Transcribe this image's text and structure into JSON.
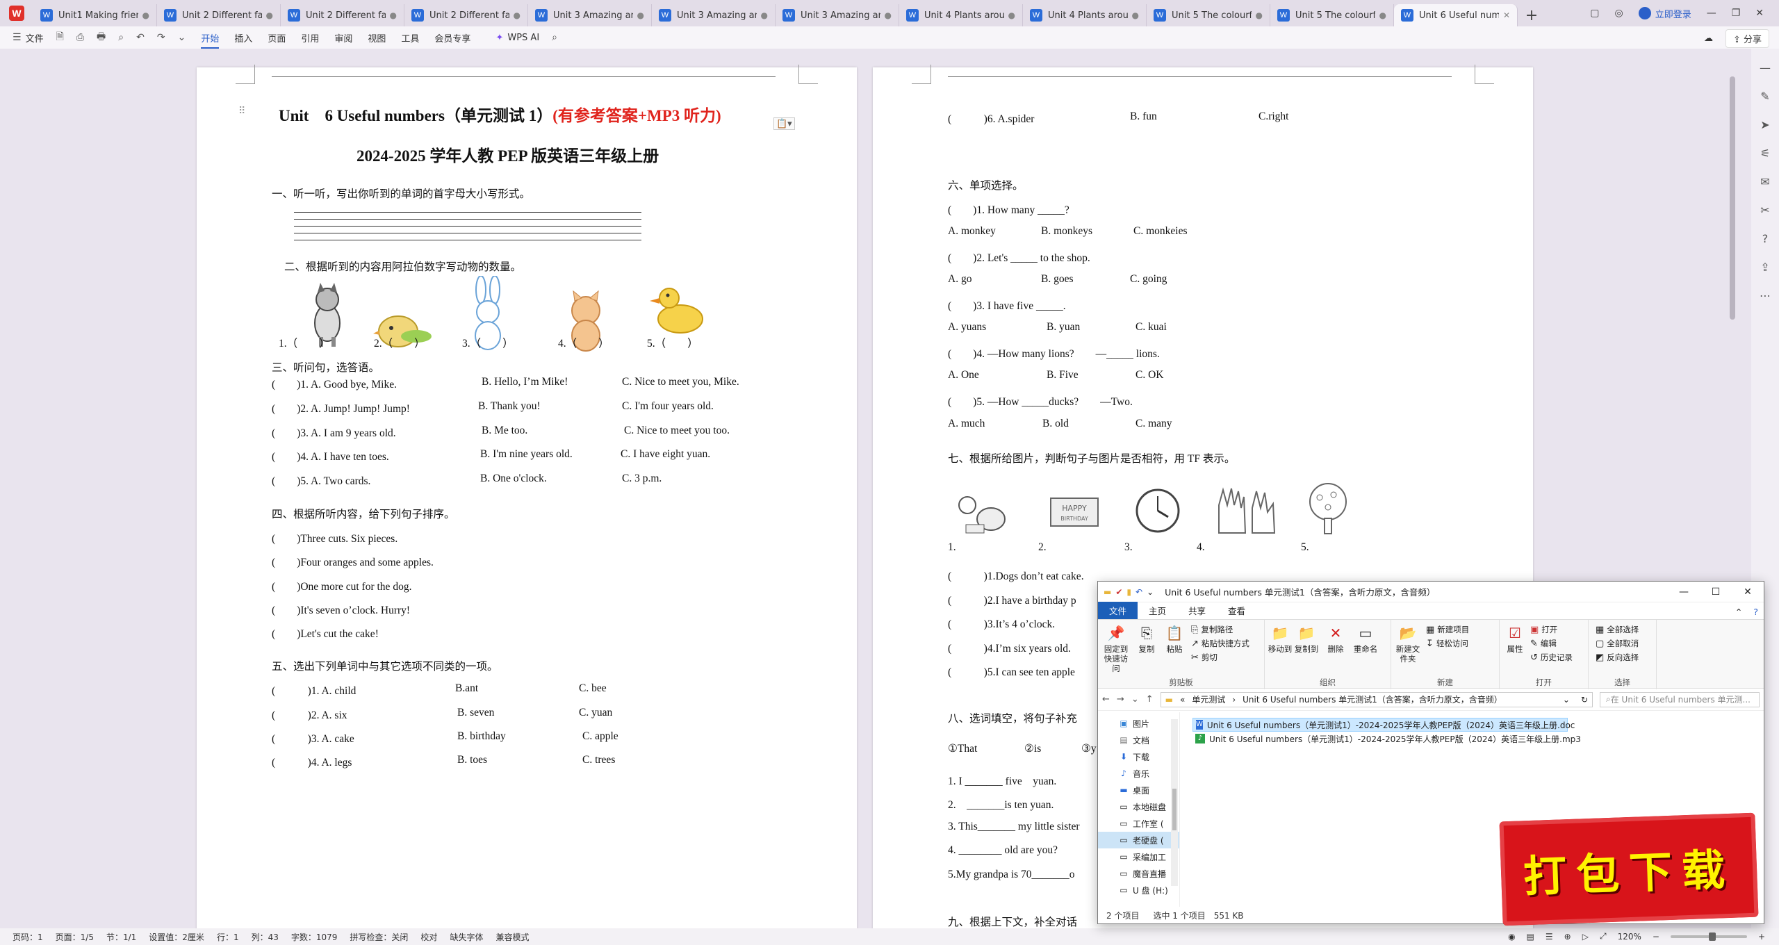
{
  "tabs": [
    {
      "label": "Unit1 Making friends"
    },
    {
      "label": "Unit 2 Different families"
    },
    {
      "label": "Unit 2 Different families"
    },
    {
      "label": "Unit 2 Different families"
    },
    {
      "label": "Unit 3 Amazing animals"
    },
    {
      "label": "Unit 3 Amazing animals"
    },
    {
      "label": "Unit 3 Amazing animals"
    },
    {
      "label": "Unit 4 Plants around us"
    },
    {
      "label": "Unit 4 Plants around us"
    },
    {
      "label": "Unit 5 The colourful world"
    },
    {
      "label": "Unit 5 The colourful world"
    },
    {
      "label": "Unit 6 Useful numbers"
    }
  ],
  "titlebar": {
    "login": "立即登录"
  },
  "menu": {
    "file": "文件",
    "items": [
      "开始",
      "插入",
      "页面",
      "引用",
      "审阅",
      "视图",
      "工具",
      "会员专享"
    ],
    "wps_ai": "WPS AI",
    "share": "分享"
  },
  "page1": {
    "title_a": "Unit　6 Useful numbers（单元测试 1）",
    "title_b": "(有参考答案+MP3 听力)",
    "subtitle": "2024-2025 学年人教 PEP 版英语三年级上册",
    "s1": "一、听一听，写出你听到的单词的首字母大小写形式。",
    "s2": "二、根据听到的内容用阿拉伯数字写动物的数量。",
    "blanks": [
      "1.（　　）",
      "2.（　　）",
      "3.（　　）",
      "4.（　　）",
      "5.（　　）"
    ],
    "s3": "三、听问句，选答语。",
    "s3q": [
      [
        "(　　)1. A. Good bye, Mike.",
        "B. Hello, I’m Mike!",
        "C. Nice to meet you, Mike."
      ],
      [
        "(　　)2. A. Jump! Jump! Jump!",
        "B. Thank you!",
        "C. I'm four years old."
      ],
      [
        "(　　)3. A. I am 9 years old.",
        "B. Me too.",
        "C. Nice to meet you too."
      ],
      [
        "(　　)4. A. I have ten toes.",
        "B. I'm nine years old.",
        "C. I have eight yuan."
      ],
      [
        "(　　)5. A. Two cards.",
        "B. One o'clock.",
        "C. 3 p.m."
      ]
    ],
    "s4": "四、根据所听内容，给下列句子排序。",
    "s4q": [
      "(　　)Three cuts. Six pieces.",
      "(　　)Four oranges and some apples.",
      "(　　)One more cut for the dog.",
      "(　　)It's seven o’clock. Hurry!",
      "(　　)Let's cut the cake!"
    ],
    "s5": "五、选出下列单词中与其它选项不同类的一项。",
    "s5q": [
      [
        "(　　　)1. A. child",
        "B.ant",
        "C. bee"
      ],
      [
        "(　　　)2. A. six",
        "B. seven",
        "C. yuan"
      ],
      [
        "(　　　)3. A. cake",
        "B. birthday",
        "C. apple"
      ],
      [
        "(　　　)4. A. legs",
        "B. toes",
        "C. trees"
      ]
    ]
  },
  "page2": {
    "top": [
      "(　　　)6. A.spider",
      "B. fun",
      "C.right"
    ],
    "s6": "六、单项选择。",
    "s6q": [
      {
        "q": "(　　)1. How many _____?",
        "a": [
          "A. monkey",
          "B. monkeys",
          "C. monkeies"
        ]
      },
      {
        "q": "(　　)2. Let's _____ to the shop.",
        "a": [
          "A. go",
          "B. goes",
          "C. going"
        ]
      },
      {
        "q": "(　　)3. I have five _____.",
        "a": [
          "A. yuans",
          "B. yuan",
          "C. kuai"
        ]
      },
      {
        "q": "(　　)4. —How many lions?　　—_____ lions.",
        "a": [
          "A. One",
          "B. Five",
          "C. OK"
        ]
      },
      {
        "q": "(　　)5. —How _____ducks?　　—Two.",
        "a": [
          "A. much",
          "B. old",
          "C. many"
        ]
      }
    ],
    "s7": "七、根据所给图片，判断句子与图片是否相符，用 TF 表示。",
    "pic_nums": [
      "1.",
      "2.",
      "3.",
      "4.",
      "5."
    ],
    "s7q": [
      "(　　　)1.Dogs don’t eat cake.",
      "(　　　)2.I have a birthday p",
      "(　　　)3.It’s 4 o’clock.",
      "(　　　)4.I’m six years old.",
      "(　　　)5.I can see ten apple"
    ],
    "s8": "八、选词填空，将句子补充",
    "s8opts": [
      "①That",
      "②is",
      "③y"
    ],
    "s8q": [
      "1. I _______ five　yuan.",
      "2.　_______is ten yuan.",
      "3. This_______ my little sister",
      "4. ________ old are you?",
      "5.My grandpa is 70_______o"
    ],
    "s9": "九、根据上下文，补全对话"
  },
  "explorer": {
    "title": "Unit 6 Useful numbers 单元测试1（含答案，含听力原文，含音频）",
    "tabs": [
      "文件",
      "主页",
      "共享",
      "查看"
    ],
    "ribbon": {
      "pin": "固定到快速访问",
      "copy": "复制",
      "paste": "粘贴",
      "copy_path": "复制路径",
      "paste_shortcut": "粘贴快捷方式",
      "cut": "剪切",
      "clipboard": "剪贴板",
      "move_to": "移动到",
      "copy_to": "复制到",
      "delete": "删除",
      "rename": "重命名",
      "organize": "组织",
      "new_folder": "新建文件夹",
      "new_item": "新建项目",
      "easy_access": "轻松访问",
      "new": "新建",
      "properties": "属性",
      "open": "打开",
      "edit": "编辑",
      "history": "历史记录",
      "open_group": "打开",
      "select_all": "全部选择",
      "select_none": "全部取消",
      "invert": "反向选择",
      "select_group": "选择"
    },
    "path": [
      "«",
      "单元测试",
      "›",
      "Unit 6 Useful numbers 单元测试1（含答案，含听力原文，含音频）"
    ],
    "search_placeholder": "在 Unit 6 Useful numbers 单元测...",
    "nav": [
      "图片",
      "文档",
      "下载",
      "音乐",
      "桌面",
      "本地磁盘",
      "工作室 (",
      "老硬盘 (",
      "采编加工",
      "魔音直播",
      "U 盘 (H:)"
    ],
    "files": [
      "Unit 6 Useful numbers（单元测试1）-2024-2025学年人教PEP版（2024）英语三年级上册.doc",
      "Unit 6 Useful numbers（单元测试1）-2024-2025学年人教PEP版（2024）英语三年级上册.mp3"
    ],
    "status": [
      "2 个项目",
      "选中 1 个项目　551 KB"
    ]
  },
  "badge": "打包下载",
  "statusbar": {
    "items": [
      "页码：1",
      "页面：1/5",
      "节：1/1",
      "设置值：2厘米",
      "行：1",
      "列：43",
      "字数：1079",
      "拼写检查：关闭",
      "校对",
      "缺失字体",
      "兼容模式"
    ],
    "zoom": "120%"
  }
}
